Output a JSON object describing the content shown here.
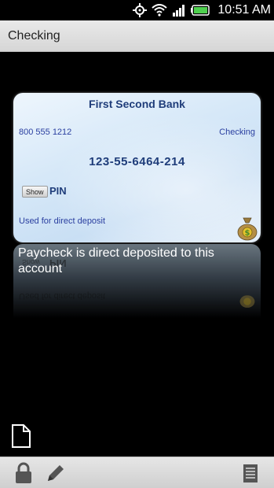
{
  "status_bar": {
    "time": "10:51",
    "am_pm": "AM"
  },
  "action_bar": {
    "title": "Checking"
  },
  "card": {
    "bank_name": "First Second Bank",
    "phone": "800 555 1212",
    "account_type": "Checking",
    "account_number": "123-55-6464-214",
    "show_button": "Show",
    "pin_label": "PIN",
    "note": "Used for direct deposit"
  },
  "description": "Paycheck is direct deposited to this account",
  "icons": {
    "gps": "gps-icon",
    "wifi": "wifi-icon",
    "signal": "signal-icon",
    "battery": "battery-icon",
    "money_bag": "money-bag-icon",
    "document": "document-icon",
    "lock": "lock-icon",
    "edit": "pencil-icon",
    "list": "list-icon"
  },
  "colors": {
    "bank_text": "#1f3d7a",
    "link_text": "#2a3fa0",
    "battery": "#4fd04f"
  }
}
